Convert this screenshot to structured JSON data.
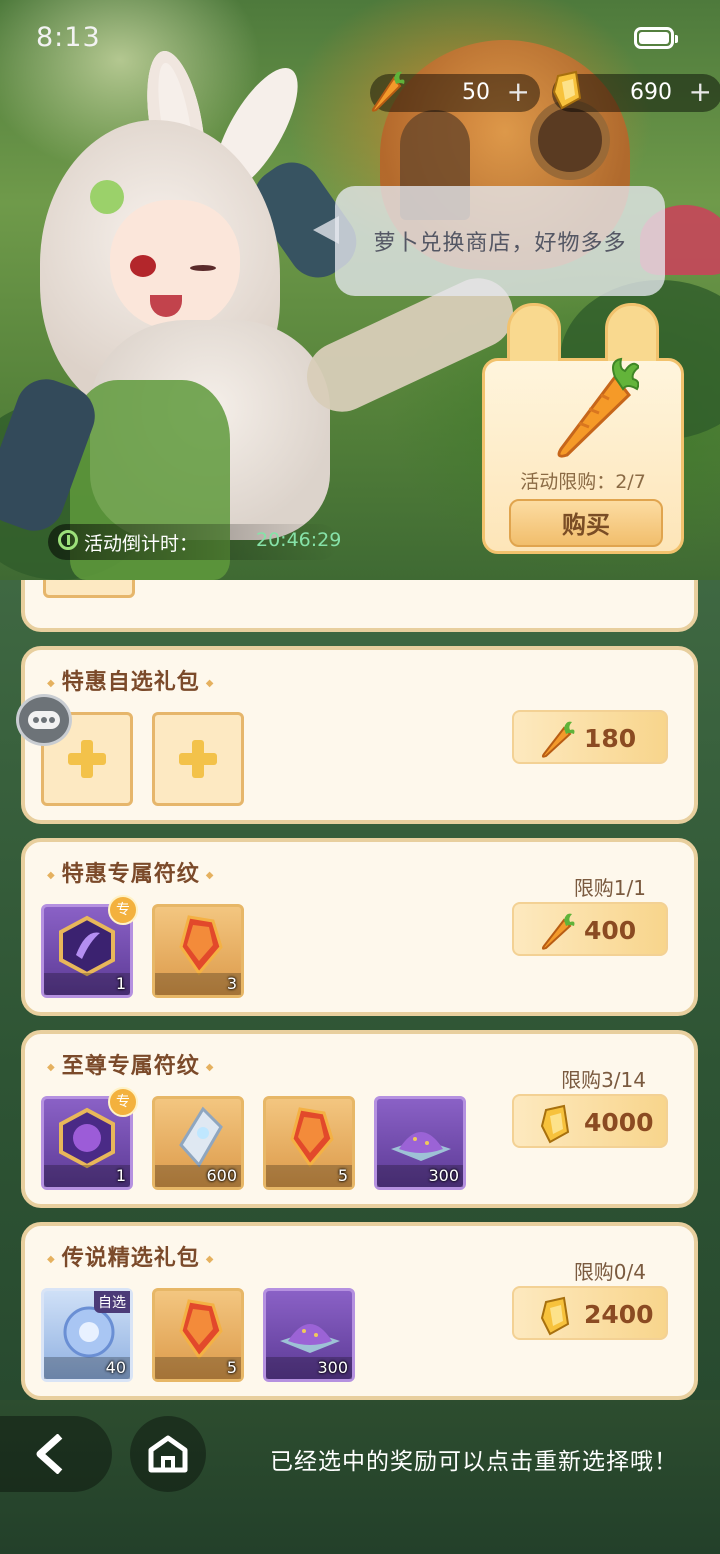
{
  "status": {
    "time": "8:13"
  },
  "currencies": [
    {
      "icon": "carrot-icon",
      "value": "50",
      "plus": "+"
    },
    {
      "icon": "gold-crystal-icon",
      "value": "690",
      "plus": "+"
    }
  ],
  "speech": "萝卜兑换商店，好物多多",
  "carrot_offer": {
    "limit": "活动限购：2/7",
    "buy_label": "购买"
  },
  "countdown": {
    "label": "活动倒计时：",
    "time": "20:46:29"
  },
  "panels": [
    {
      "title": "特惠自选礼包",
      "limit": "",
      "price": {
        "currency": "carrot-icon",
        "value": "180"
      },
      "items": []
    },
    {
      "title": "特惠专属符纹",
      "limit": "限购1/1",
      "price": {
        "currency": "carrot-icon",
        "value": "400"
      },
      "items": [
        {
          "name": "purple-rune-icon",
          "count": "1"
        },
        {
          "name": "orange-crystal-icon",
          "count": "3"
        }
      ]
    },
    {
      "title": "至尊专属符纹",
      "limit": "限购3/14",
      "price": {
        "currency": "gold-crystal-icon",
        "value": "4000"
      },
      "items": [
        {
          "name": "purple-rune-icon",
          "count": "1"
        },
        {
          "name": "white-crystal-icon",
          "count": "600"
        },
        {
          "name": "orange-crystal-icon",
          "count": "5"
        },
        {
          "name": "purple-dust-icon",
          "count": "300"
        }
      ]
    },
    {
      "title": "传说精选礼包",
      "limit": "限购0/4",
      "price": {
        "currency": "gold-crystal-icon",
        "value": "2400"
      },
      "items": [
        {
          "name": "blue-orb-icon",
          "count": "40",
          "tag": "自选"
        },
        {
          "name": "orange-crystal-icon",
          "count": "5"
        },
        {
          "name": "purple-dust-icon",
          "count": "300"
        }
      ]
    }
  ],
  "hint": "已经选中的奖励可以点击重新选择哦！",
  "colors": {
    "panel_bg": "#fef8ec",
    "panel_border": "#e8cf9e",
    "accent_orange": "#f5a33b",
    "countdown_green": "#86e2a8"
  }
}
